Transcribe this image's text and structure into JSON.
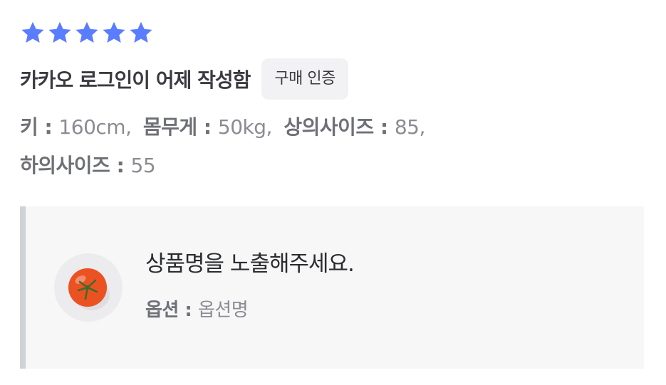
{
  "rating": {
    "value": 5,
    "max": 5,
    "star_color": "#5a7cff"
  },
  "review": {
    "author_text": "카카오 로그인이 어제 작성함",
    "badge_label": "구매 인증"
  },
  "body_info": {
    "height": {
      "label": "키",
      "value": "160cm,"
    },
    "weight": {
      "label": "몸무게",
      "value": "50kg,"
    },
    "top_size": {
      "label": "상의사이즈",
      "value": "85,"
    },
    "bottom_size": {
      "label": "하의사이즈",
      "value": "55"
    },
    "separator": ":"
  },
  "product": {
    "name": "상품명을 노출해주세요.",
    "option_label": "옵션",
    "option_value": "옵션명",
    "thumbnail_icon": "tomato-icon"
  }
}
